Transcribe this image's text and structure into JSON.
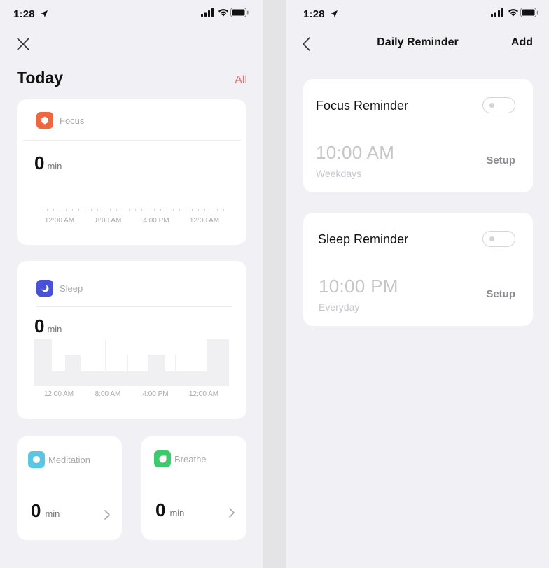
{
  "status_bar": {
    "time": "1:28"
  },
  "today": {
    "title": "Today",
    "all_link": "All",
    "focus": {
      "label": "Focus",
      "value": "0",
      "unit": "min",
      "icon": "hexagon-icon",
      "color": "#f0663f",
      "ticks": [
        "12:00 AM",
        "8:00 AM",
        "4:00 PM",
        "12:00 AM"
      ]
    },
    "sleep": {
      "label": "Sleep",
      "value": "0",
      "unit": "min",
      "icon": "moon-icon",
      "color": "#4752d6",
      "ticks": [
        "12:00 AM",
        "8:00 AM",
        "4:00 PM",
        "12:00 AM"
      ]
    },
    "meditation": {
      "label": "Meditation",
      "value": "0",
      "unit": "min",
      "icon": "circle-icon",
      "color": "#5bc6e3"
    },
    "breathe": {
      "label": "Breathe",
      "value": "0",
      "unit": "min",
      "icon": "leaf-icon",
      "color": "#3ec96b"
    }
  },
  "reminder": {
    "title": "Daily Reminder",
    "add_label": "Add",
    "items": [
      {
        "title": "Focus Reminder",
        "time": "10:00 AM",
        "repeat": "Weekdays",
        "setup_label": "Setup",
        "enabled": false
      },
      {
        "title": "Sleep Reminder",
        "time": "10:00 PM",
        "repeat": "Everyday",
        "setup_label": "Setup",
        "enabled": false
      }
    ]
  }
}
